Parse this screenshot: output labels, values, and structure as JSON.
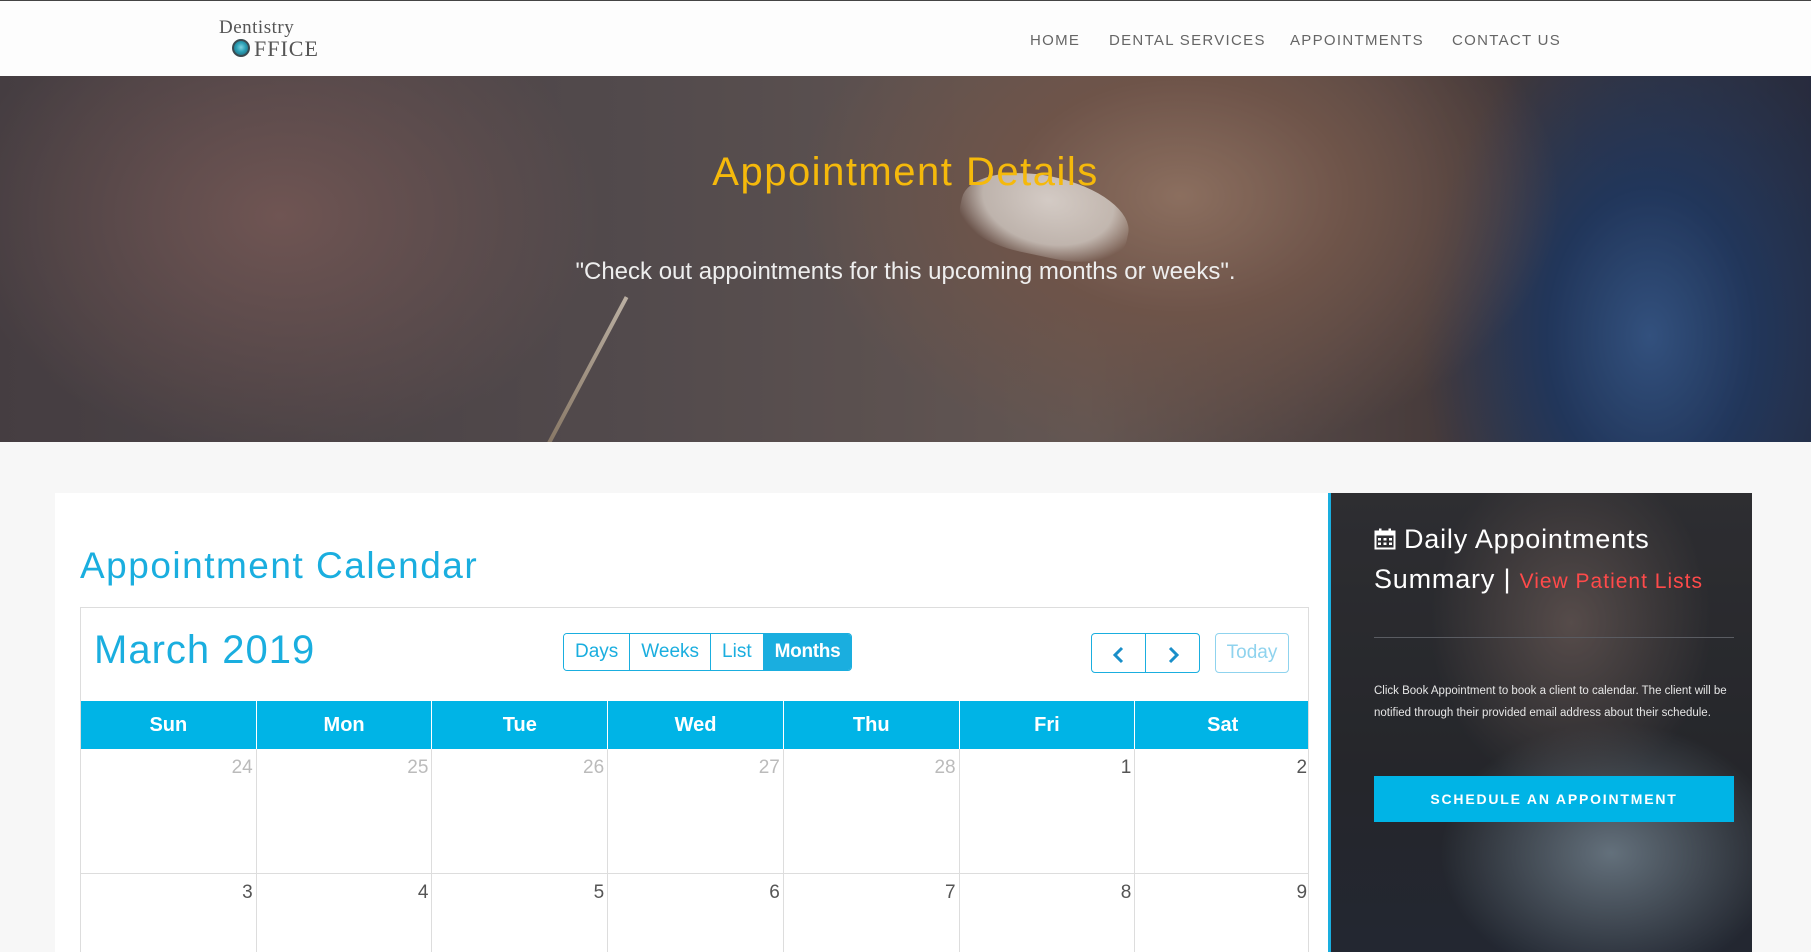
{
  "brand": {
    "line1": "Dentistry",
    "line2_rest": "FFICE"
  },
  "nav": {
    "items": [
      "HOME",
      "DENTAL SERVICES",
      "APPOINTMENTS",
      "CONTACT US"
    ]
  },
  "hero": {
    "title": "Appointment Details",
    "subtitle": "\"Check out appointments for this upcoming months or weeks\"."
  },
  "calendar": {
    "heading": "Appointment Calendar",
    "month_title": "March 2019",
    "views": [
      "Days",
      "Weeks",
      "List",
      "Months"
    ],
    "active_view": "Months",
    "prev_icon": "chevron-left",
    "next_icon": "chevron-right",
    "today_label": "Today",
    "weekdays": [
      "Sun",
      "Mon",
      "Tue",
      "Wed",
      "Thu",
      "Fri",
      "Sat"
    ],
    "weeks": [
      [
        {
          "day": "24",
          "muted": true
        },
        {
          "day": "25",
          "muted": true
        },
        {
          "day": "26",
          "muted": true
        },
        {
          "day": "27",
          "muted": true
        },
        {
          "day": "28",
          "muted": true
        },
        {
          "day": "1",
          "muted": false
        },
        {
          "day": "2",
          "muted": false
        }
      ],
      [
        {
          "day": "3",
          "muted": false
        },
        {
          "day": "4",
          "muted": false
        },
        {
          "day": "5",
          "muted": false
        },
        {
          "day": "6",
          "muted": false
        },
        {
          "day": "7",
          "muted": false
        },
        {
          "day": "8",
          "muted": false
        },
        {
          "day": "9",
          "muted": false
        }
      ]
    ]
  },
  "sidebar": {
    "title": "Daily Appointments Summary",
    "separator": "|",
    "link": "View Patient Lists",
    "description": "Click Book Appointment to book a client to calendar. The client will be notified through their provided email address about their schedule.",
    "button": "SCHEDULE AN APPOINTMENT"
  },
  "colors": {
    "accent": "#1aaedf",
    "header_blue": "#00b4e6",
    "hero_title": "#f5b90b",
    "link_red": "#ff4a4a"
  }
}
